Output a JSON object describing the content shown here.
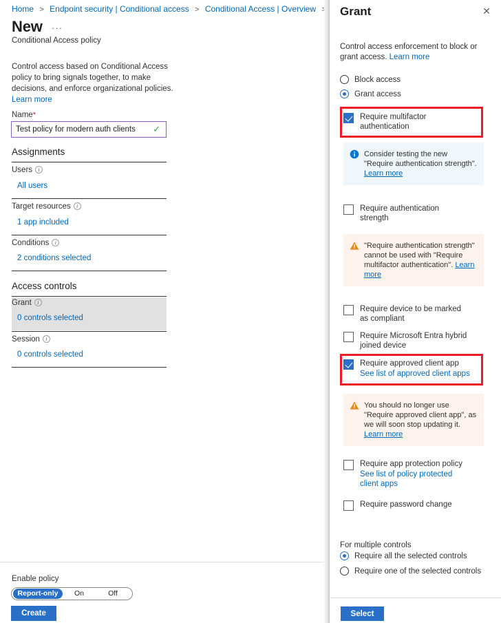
{
  "breadcrumb": {
    "items": [
      "Home",
      "Endpoint security | Conditional access",
      "Conditional Access | Overview"
    ],
    "separator": ">"
  },
  "left": {
    "title": "New",
    "ellipsis": "···",
    "subtitle": "Conditional Access policy",
    "intro": "Control access based on Conditional Access policy to bring signals together, to make decisions, and enforce organizational policies.",
    "intro_link": "Learn more",
    "name_label": "Name",
    "name_required_marker": "*",
    "name_value": "Test policy for modern auth clients",
    "name_valid_icon": "checkmark-icon",
    "assignments_heading": "Assignments",
    "rows": [
      {
        "label": "Users",
        "value": "All users",
        "info_icon": "info-icon"
      },
      {
        "label": "Target resources",
        "value": "1 app included",
        "info_icon": "info-icon"
      },
      {
        "label": "Conditions",
        "value": "2 conditions selected",
        "info_icon": "info-icon"
      }
    ],
    "access_controls_heading": "Access controls",
    "access_rows": [
      {
        "label": "Grant",
        "value": "0 controls selected",
        "info_icon": "info-icon",
        "selected": true
      },
      {
        "label": "Session",
        "value": "0 controls selected",
        "info_icon": "info-icon",
        "selected": false
      }
    ],
    "enable_policy_label": "Enable policy",
    "enable_options": [
      "Report-only",
      "On",
      "Off"
    ],
    "enable_selected": "Report-only",
    "create_label": "Create"
  },
  "panel": {
    "title": "Grant",
    "close_icon": "close-icon",
    "description": "Control access enforcement to block or grant access. ",
    "description_link": "Learn more",
    "access_mode": [
      {
        "label": "Block access",
        "selected": false
      },
      {
        "label": "Grant access",
        "selected": true
      }
    ],
    "controls": [
      {
        "label": "Require multifactor authentication",
        "checked": true,
        "info_icon": "info-icon",
        "sublink": null,
        "highlighted": true
      },
      {
        "label": "Require authentication strength",
        "checked": false,
        "info_icon": "info-icon",
        "sublink": null,
        "highlighted": false
      },
      {
        "label": "Require device to be marked as compliant",
        "checked": false,
        "info_icon": "info-icon",
        "sublink": null,
        "highlighted": false
      },
      {
        "label": "Require Microsoft Entra hybrid joined device",
        "checked": false,
        "info_icon": "info-icon",
        "sublink": null,
        "highlighted": false
      },
      {
        "label": "Require approved client app",
        "checked": true,
        "info_icon": "info-icon",
        "sublink": "See list of approved client apps",
        "highlighted": true
      },
      {
        "label": "Require app protection policy",
        "checked": false,
        "info_icon": "info-icon",
        "sublink": "See list of policy protected client apps",
        "highlighted": false
      },
      {
        "label": "Require password change",
        "checked": false,
        "info_icon": "info-icon",
        "sublink": null,
        "highlighted": false
      }
    ],
    "messages": {
      "info_mfa": {
        "icon": "info-filled-icon",
        "text": "Consider testing the new \"Require authentication strength\". ",
        "link": "Learn more"
      },
      "warn_strength": {
        "icon": "warning-icon",
        "text": "\"Require authentication strength\" cannot be used with \"Require multifactor authentication\". ",
        "link": "Learn more"
      },
      "warn_approved_app": {
        "icon": "warning-icon",
        "text": "You should no longer use \"Require approved client app\", as we will soon stop updating it. ",
        "link": "Learn more"
      }
    },
    "multiple_controls_label": "For multiple controls",
    "multiple_controls_options": [
      {
        "label": "Require all the selected controls",
        "selected": true
      },
      {
        "label": "Require one of the selected controls",
        "selected": false
      }
    ],
    "select_label": "Select"
  },
  "colors": {
    "accent": "#2a70c8",
    "link": "#0067b8",
    "annotation": "#ec1c24",
    "info_bg": "#eff6fc",
    "warn_bg": "#fdf3ec",
    "input_border": "#8661c5",
    "valid_check": "#4a9e4a",
    "selected_row_bg": "#e1e1e1"
  }
}
